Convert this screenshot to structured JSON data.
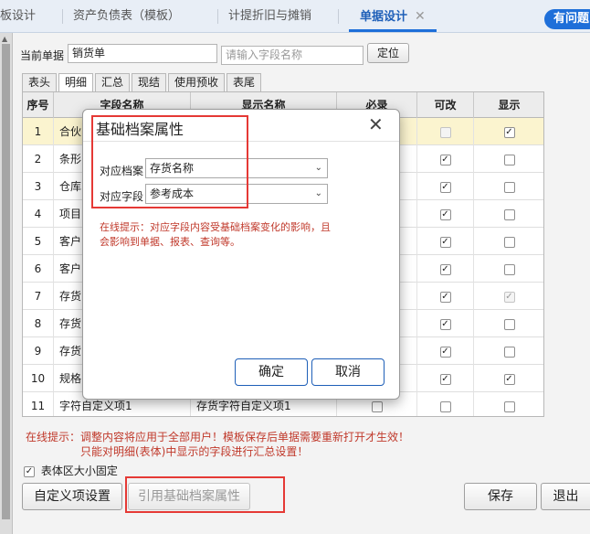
{
  "tabs": {
    "t1": "板设计",
    "t2": "资产负债表（模板）",
    "t3": "计提折旧与摊销",
    "t4": "单据设计",
    "close": "✕",
    "help": "有问题"
  },
  "bill": {
    "label": "当前单据",
    "value": "销货单",
    "field_placeholder": "请输入字段名称",
    "locate": "定位"
  },
  "subtabs": [
    "表头",
    "明细",
    "汇总",
    "现结",
    "使用预收",
    "表尾"
  ],
  "grid": {
    "headers": [
      "序号",
      "字段名称",
      "显示名称",
      "必录",
      "可改",
      "显示"
    ],
    "rows": [
      {
        "no": "1",
        "field": "合伙",
        "disp": "",
        "req": "dim",
        "edit": "dim",
        "show": "checked"
      },
      {
        "no": "2",
        "field": "条形",
        "disp": "",
        "req": "",
        "edit": "checked",
        "show": ""
      },
      {
        "no": "3",
        "field": "仓库",
        "disp": "",
        "req": "",
        "edit": "checked",
        "show": ""
      },
      {
        "no": "4",
        "field": "项目",
        "disp": "",
        "req": "",
        "edit": "checked",
        "show": ""
      },
      {
        "no": "5",
        "field": "客户",
        "disp": "",
        "req": "",
        "edit": "checked",
        "show": ""
      },
      {
        "no": "6",
        "field": "客户",
        "disp": "",
        "req": "",
        "edit": "checked",
        "show": ""
      },
      {
        "no": "7",
        "field": "存货",
        "disp": "",
        "req": "",
        "edit": "checked",
        "show": "dimchecked"
      },
      {
        "no": "8",
        "field": "存货",
        "disp": "",
        "req": "",
        "edit": "checked",
        "show": ""
      },
      {
        "no": "9",
        "field": "存货",
        "disp": "",
        "req": "",
        "edit": "checked",
        "show": ""
      },
      {
        "no": "10",
        "field": "规格",
        "disp": "",
        "req": "",
        "edit": "checked",
        "show": "checked"
      },
      {
        "no": "11",
        "field": "字符自定义项1",
        "disp": "存货字符自定义项1",
        "req": "",
        "edit": "",
        "show": ""
      }
    ]
  },
  "hints": {
    "line1": "在线提示：调整内容将应用于全部用户！模板保存后单据需要重新打开才生效！",
    "line2": "只能对明细(表体)中显示的字段进行汇总设置！"
  },
  "fixed_size_label": "表体区大小固定",
  "buttons": {
    "custom": "自定义项设置",
    "cite": "引用基础档案属性",
    "save": "保存",
    "exit": "退出"
  },
  "modal": {
    "title": "基础档案属性",
    "close": "✕",
    "archive_label": "对应档案",
    "archive_value": "存货名称",
    "field_label": "对应字段",
    "field_value": "参考成本",
    "hint_line1": "在线提示：对应字段内容受基础档案变化的影响，且",
    "hint_line2": "会影响到单据、报表、查询等。",
    "ok": "确定",
    "cancel": "取消"
  },
  "colors": {
    "accent": "#1e6fd9",
    "hint_red": "#c0392b",
    "highlight_box": "#e53935",
    "selected_row": "#fbf4cf"
  }
}
